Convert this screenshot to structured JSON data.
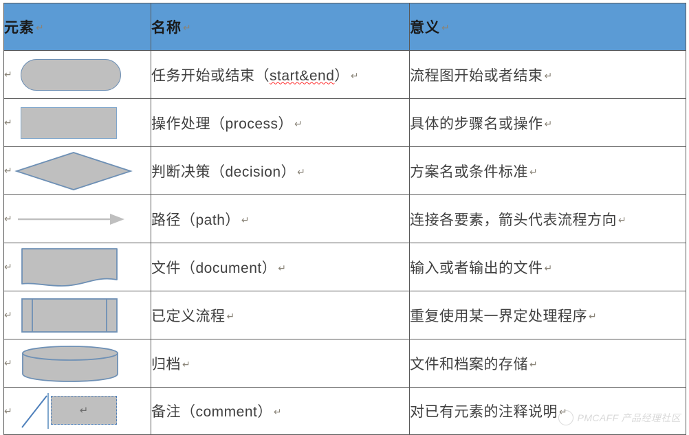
{
  "table": {
    "headers": [
      {
        "label": "元素",
        "mark": "↵"
      },
      {
        "label": "名称",
        "mark": "↵"
      },
      {
        "label": "意义",
        "mark": "↵"
      }
    ],
    "header_bg": "#5B9BD5",
    "rows": [
      {
        "shape": "start-end-stadium",
        "lead_mark": "↵",
        "name": "任务开始或结束（start&end）",
        "name_cjk": "任务开始或结束（",
        "name_latin": "start&end",
        "name_tail": "）",
        "name_mark": "↵",
        "meaning": "流程图开始或者结束",
        "meaning_mark": "↵"
      },
      {
        "shape": "process-rect",
        "lead_mark": "↵",
        "name": "操作处理（process）",
        "name_cjk": "操作处理（",
        "name_latin": "process",
        "name_tail": "）",
        "name_mark": "↵",
        "meaning": "具体的步骤名或操作",
        "meaning_mark": "↵"
      },
      {
        "shape": "decision-diamond",
        "lead_mark": "↵",
        "name": "判断决策（decision）",
        "name_cjk": "判断决策（",
        "name_latin": "decision",
        "name_tail": "）",
        "name_mark": "↵",
        "meaning": "方案名或条件标准",
        "meaning_mark": "↵"
      },
      {
        "shape": "path-arrow",
        "lead_mark": "↵",
        "name": "路径（path）",
        "name_cjk": "路径（",
        "name_latin": "path",
        "name_tail": "）",
        "name_mark": "↵",
        "meaning": "连接各要素，箭头代表流程方向",
        "meaning_mark": "↵"
      },
      {
        "shape": "document-wave",
        "lead_mark": "↵",
        "name": "文件（document）",
        "name_cjk": "文件（",
        "name_latin": "document",
        "name_tail": "）",
        "name_mark": "↵",
        "meaning": "输入或者输出的文件",
        "meaning_mark": "↵"
      },
      {
        "shape": "predefined-process",
        "lead_mark": "↵",
        "name": "已定义流程",
        "name_cjk": "已定义流程",
        "name_latin": "",
        "name_tail": "",
        "name_mark": "↵",
        "meaning": "重复使用某一界定处理程序",
        "meaning_mark": "↵"
      },
      {
        "shape": "archive-cylinder",
        "lead_mark": "↵",
        "name": "归档",
        "name_cjk": "归档",
        "name_latin": "",
        "name_tail": "",
        "name_mark": "↵",
        "meaning": "文件和档案的存储",
        "meaning_mark": "↵"
      },
      {
        "shape": "comment-annotation",
        "lead_mark": "↵",
        "name": "备注（comment）",
        "name_cjk": "备注（",
        "name_latin": "comment",
        "name_tail": "）",
        "name_mark": "↵",
        "meaning": "对已有元素的注释说明",
        "meaning_mark": "↵",
        "inner_mark": "↵"
      }
    ]
  },
  "shape_colors": {
    "fill": "#BFBFBF",
    "stroke": "#6E90B5",
    "arrow": "#BFBFBF"
  },
  "watermark": {
    "text": "PMCAFF 产品经理社区",
    "logo_icon": "circle-logo-icon"
  }
}
